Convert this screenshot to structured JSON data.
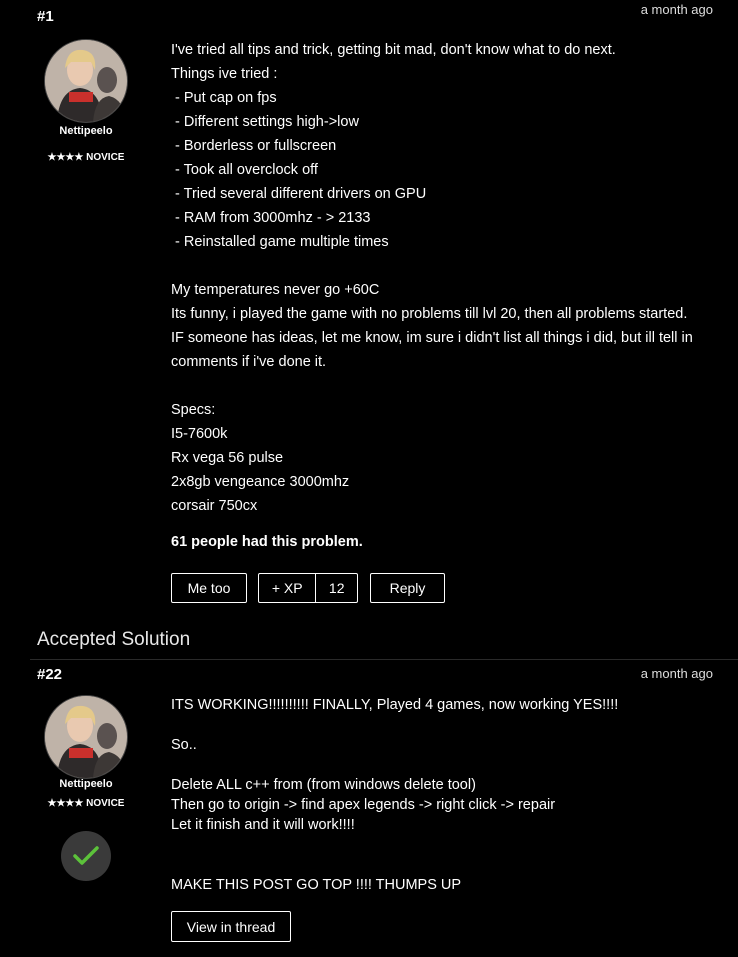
{
  "post1": {
    "number": "#1",
    "time": "a month ago",
    "username": "Nettipeelo",
    "rank": "★★★★ NOVICE",
    "lines": [
      "I've tried all tips and trick, getting bit mad, don't know what to do next.",
      "Things ive tried :",
      " - Put cap on fps",
      " - Different settings high->low",
      " - Borderless or fullscreen",
      " - Took all overclock off",
      " - Tried several different drivers on GPU",
      " - RAM from 3000mhz - > 2133",
      " - Reinstalled game multiple times",
      "",
      "My temperatures never go +60C",
      "Its funny, i played the game with no problems till lvl 20, then all problems started.",
      "IF someone has ideas, let me know, im sure i didn't list all things i did, but ill tell in",
      "comments if i've done it.",
      "",
      "Specs:",
      "I5-7600k",
      "Rx vega 56 pulse",
      "2x8gb vengeance 3000mhz",
      "corsair 750cx"
    ],
    "problem_count": "61 people had this problem.",
    "buttons": {
      "me_too": "Me too",
      "xp": "+ XP",
      "xp_count": "12",
      "reply": "Reply"
    }
  },
  "accepted": {
    "title": "Accepted Solution"
  },
  "post22": {
    "number": "#22",
    "time": "a month ago",
    "username": "Nettipeelo",
    "rank": "★★★★ NOVICE",
    "lines": [
      "ITS WORKING!!!!!!!!!! FINALLY, Played 4 games, now working YES!!!!",
      "",
      "So..",
      "",
      "Delete ALL c++ from (from windows delete tool)",
      "Then go to origin -> find apex legends -> right click -> repair",
      "Let it finish and it will work!!!!",
      "",
      "",
      "MAKE THIS POST GO TOP !!!! THUMPS UP"
    ],
    "view_button": "View in thread"
  },
  "colors": {
    "background": "#000000",
    "check": "#5cc23a",
    "check_bg": "#3a3a3a"
  },
  "icons": {
    "check": "check-icon",
    "avatar": "avatar-image"
  }
}
